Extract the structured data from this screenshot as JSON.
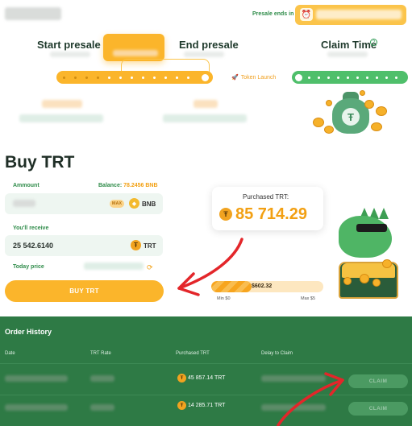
{
  "header": {
    "presale_ends_label": "Presale ends in",
    "timer_icon": "alarm-clock-icon"
  },
  "steps": {
    "start": "Start presale",
    "end": "End presale",
    "claim": "Claim Time",
    "token_launch": "Token Launch"
  },
  "buy": {
    "title": "Buy TRT",
    "amount_label": "Ammount",
    "balance_prefix": "Balance: ",
    "balance_value": "78.2456 BNB",
    "max_label": "MAX",
    "bnb_label": "BNB",
    "receive_label": "You'll receive",
    "receive_value": "25 542.6140",
    "trt_label": "TRT",
    "today_price_label": "Today price",
    "buy_button": "BUY TRT"
  },
  "purchased": {
    "title": "Purchased TRT:",
    "amount": "85 714.29"
  },
  "raise": {
    "value_label": "$602.32",
    "min_label": "Min $0",
    "max_label": "Max $5",
    "fill_fraction": 0.36
  },
  "orders": {
    "title": "Order History",
    "columns": [
      "Date",
      "TRT Rate",
      "Purchased TRT",
      "Delay to Claim"
    ],
    "rows": [
      {
        "purchased": "45 857.14 TRT",
        "claim_label": "CLAIM"
      },
      {
        "purchased": "14 285.71 TRT",
        "claim_label": "CLAIM"
      }
    ]
  },
  "colors": {
    "accent": "#fbb52b",
    "green": "#2e7a45",
    "brand_green": "#4fbf6b"
  }
}
